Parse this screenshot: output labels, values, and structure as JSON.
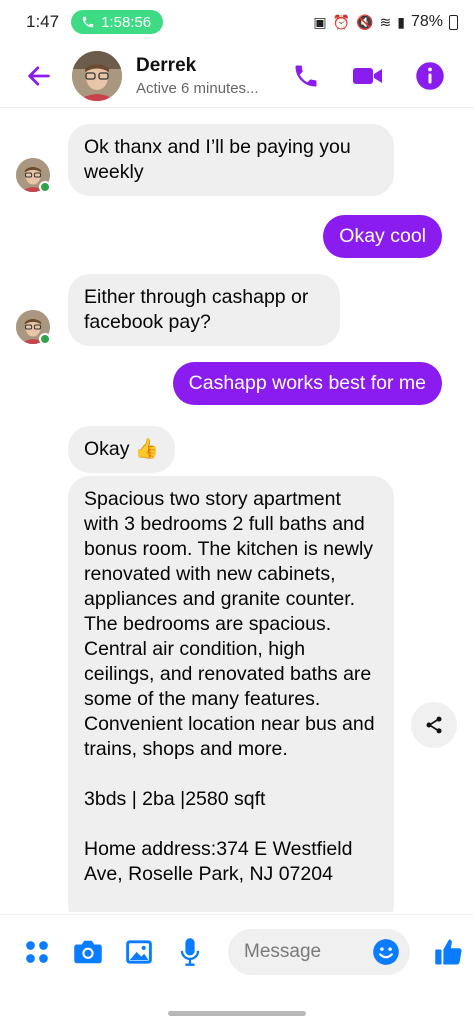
{
  "status_bar": {
    "time": "1:47",
    "call_timer": "1:58:56",
    "battery": "78%"
  },
  "header": {
    "contact_name": "Derrek",
    "contact_status": "Active 6 minutes..."
  },
  "messages": [
    {
      "from": "them",
      "text": "Ok thanx and I’ll be paying you weekly"
    },
    {
      "from": "me",
      "text": "Okay cool"
    },
    {
      "from": "them",
      "text": "Either through cashapp or facebook pay?"
    },
    {
      "from": "me",
      "text": "Cashapp works best for me"
    },
    {
      "from": "them",
      "text": "Okay 👍"
    },
    {
      "from": "them",
      "text": "Spacious two story apartment with 3 bedrooms 2 full baths and bonus room. The kitchen is newly renovated with new cabinets, appliances and granite counter. The bedrooms are spacious. Central air condition, high ceilings, and renovated baths are some of the many features. Convenient location near bus and trains, shops and more.",
      "extra_1": "3bds | 2ba |2580 sqft",
      "extra_2": "Home address:374 E Westfield Ave, Roselle Park, NJ 07204"
    }
  ],
  "composer": {
    "placeholder": "Message"
  },
  "colors": {
    "accent": "#8a1cf0",
    "incoming_bubble": "#efefef",
    "composer_icons": "#0a7cff",
    "online": "#31a24c"
  },
  "icons": {
    "back": "arrow-left-icon",
    "call": "phone-icon",
    "video": "video-camera-icon",
    "info": "info-icon",
    "share": "share-icon",
    "menu": "four-dots-icon",
    "camera": "camera-icon",
    "gallery": "image-icon",
    "mic": "microphone-icon",
    "emoji": "smiley-icon",
    "like": "thumbs-up-icon"
  }
}
